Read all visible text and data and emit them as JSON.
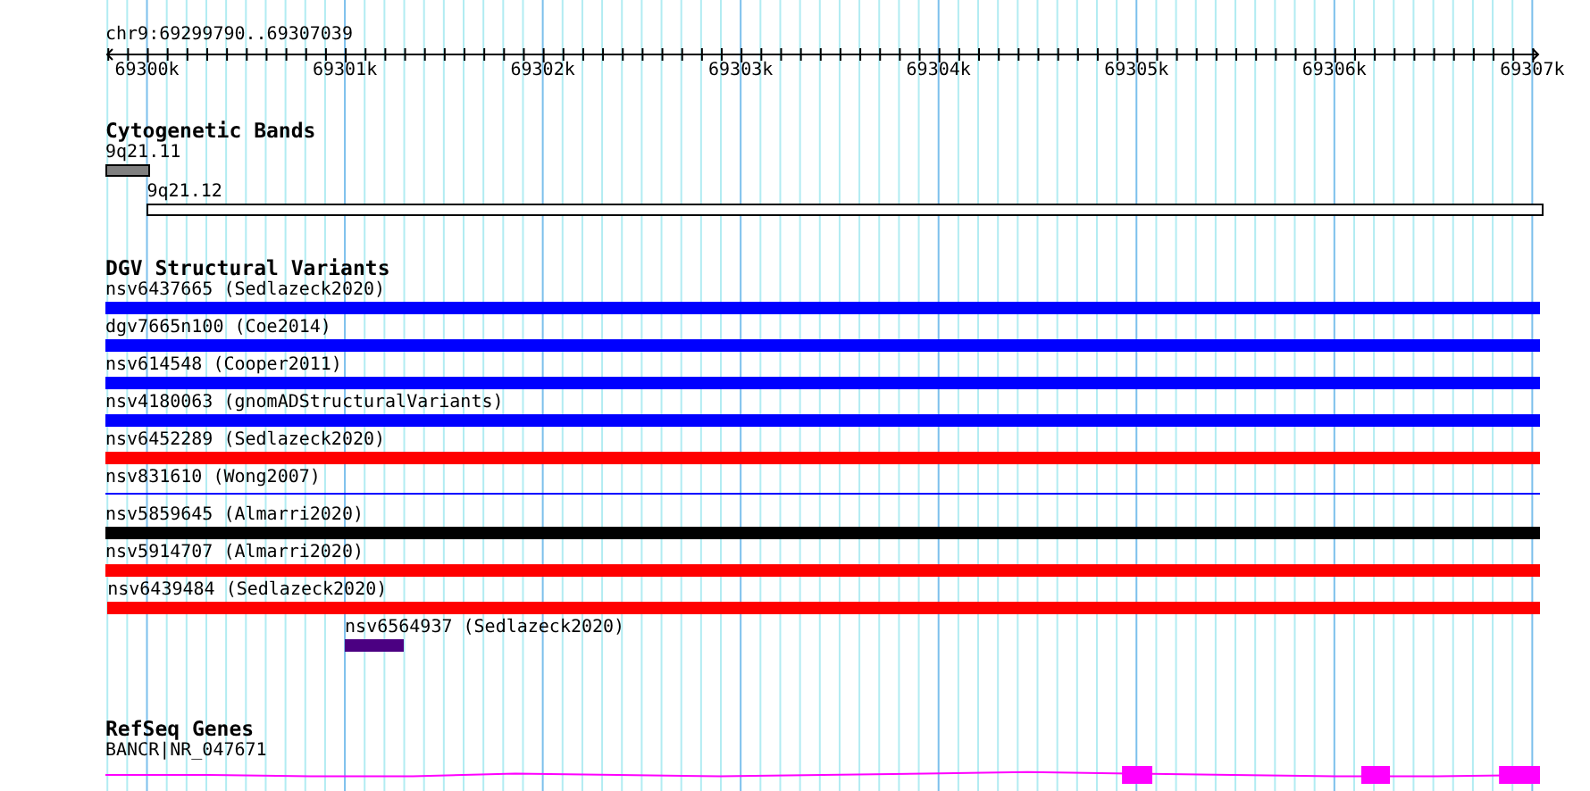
{
  "ruler": {
    "title": "chr9:69299790..69307039",
    "ticks": [
      {
        "label": "69300k"
      },
      {
        "label": "69301k"
      },
      {
        "label": "69302k"
      },
      {
        "label": "69303k"
      },
      {
        "label": "69304k"
      },
      {
        "label": "69305k"
      },
      {
        "label": "69306k"
      },
      {
        "label": "69307k"
      }
    ]
  },
  "tracks": [
    {
      "title": "Cytogenetic Bands",
      "kind": "bands",
      "features": [
        {
          "label": "9q21.11",
          "color": "#808080"
        },
        {
          "label": "9q21.12",
          "color": "#ffffff"
        }
      ]
    },
    {
      "title": "DGV Structural Variants",
      "kind": "variants",
      "features": [
        {
          "label": "nsv6437665 (Sedlazeck2020)",
          "color": "#0000ff",
          "kind": "thick"
        },
        {
          "label": "dgv7665n100 (Coe2014)",
          "color": "#0000ff",
          "kind": "thick"
        },
        {
          "label": "nsv614548 (Cooper2011)",
          "color": "#0000ff",
          "kind": "thick"
        },
        {
          "label": "nsv4180063 (gnomADStructuralVariants)",
          "color": "#0000ff",
          "kind": "thick"
        },
        {
          "label": "nsv6452289 (Sedlazeck2020)",
          "color": "#ff0000",
          "kind": "thick"
        },
        {
          "label": "nsv831610 (Wong2007)",
          "color": "#0000ff",
          "kind": "thin"
        },
        {
          "label": "nsv5859645 (Almarri2020)",
          "color": "#000000",
          "kind": "thick"
        },
        {
          "label": "nsv5914707 (Almarri2020)",
          "color": "#ff0000",
          "kind": "thick"
        },
        {
          "label": "nsv6439484 (Sedlazeck2020)",
          "color": "#ff0000",
          "kind": "thick"
        },
        {
          "label": "nsv6564937 (Sedlazeck2020)",
          "color": "#4b0082",
          "kind": "thick"
        }
      ]
    },
    {
      "title": "RefSeq Genes",
      "kind": "genes",
      "features": [
        {
          "label": "BANCR|NR_047671",
          "color": "#ff00ff"
        }
      ]
    }
  ]
}
